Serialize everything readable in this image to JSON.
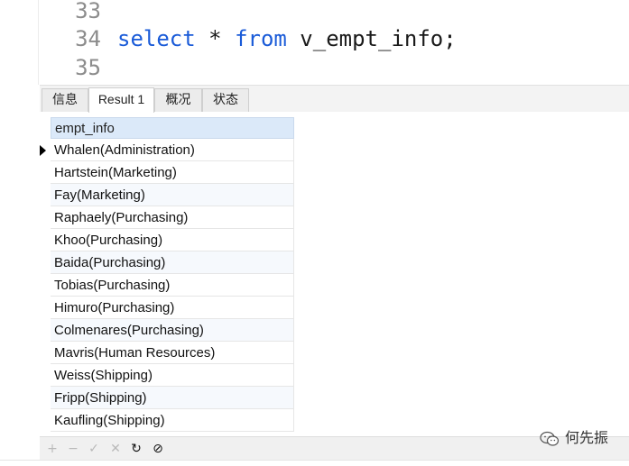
{
  "editor": {
    "lines": [
      {
        "number": "33",
        "parts": []
      },
      {
        "number": "34",
        "parts": [
          {
            "text": "select",
            "kind": "keyword"
          },
          {
            "text": " * ",
            "kind": "operator"
          },
          {
            "text": "from",
            "kind": "keyword"
          },
          {
            "text": " v_empt_info;",
            "kind": "identifier"
          }
        ]
      },
      {
        "number": "35",
        "parts": []
      }
    ],
    "keyword_color": "#1a5bd8"
  },
  "tabs": [
    {
      "label": "信息",
      "active": false
    },
    {
      "label": "Result 1",
      "active": true
    },
    {
      "label": "概况",
      "active": false
    },
    {
      "label": "状态",
      "active": false
    }
  ],
  "grid": {
    "column": "empt_info",
    "selected_row": 0,
    "rows": [
      "Whalen(Administration)",
      "Hartstein(Marketing)",
      "Fay(Marketing)",
      "Raphaely(Purchasing)",
      "Khoo(Purchasing)",
      "Baida(Purchasing)",
      "Tobias(Purchasing)",
      "Himuro(Purchasing)",
      "Colmenares(Purchasing)",
      "Mavris(Human Resources)",
      "Weiss(Shipping)",
      "Fripp(Shipping)",
      "Kaufling(Shipping)"
    ]
  },
  "toolbar": {
    "buttons": [
      {
        "name": "add-record-button",
        "glyph": "+",
        "enabled": false
      },
      {
        "name": "delete-record-button",
        "glyph": "−",
        "enabled": false
      },
      {
        "name": "apply-changes-button",
        "glyph": "✓",
        "enabled": false
      },
      {
        "name": "discard-changes-button",
        "glyph": "✕",
        "enabled": false
      },
      {
        "name": "refresh-button",
        "glyph": "↻",
        "enabled": true
      },
      {
        "name": "stop-button",
        "glyph": "⊘",
        "enabled": true
      }
    ]
  },
  "watermark": {
    "text": "何先振",
    "icon": "wechat-icon"
  }
}
